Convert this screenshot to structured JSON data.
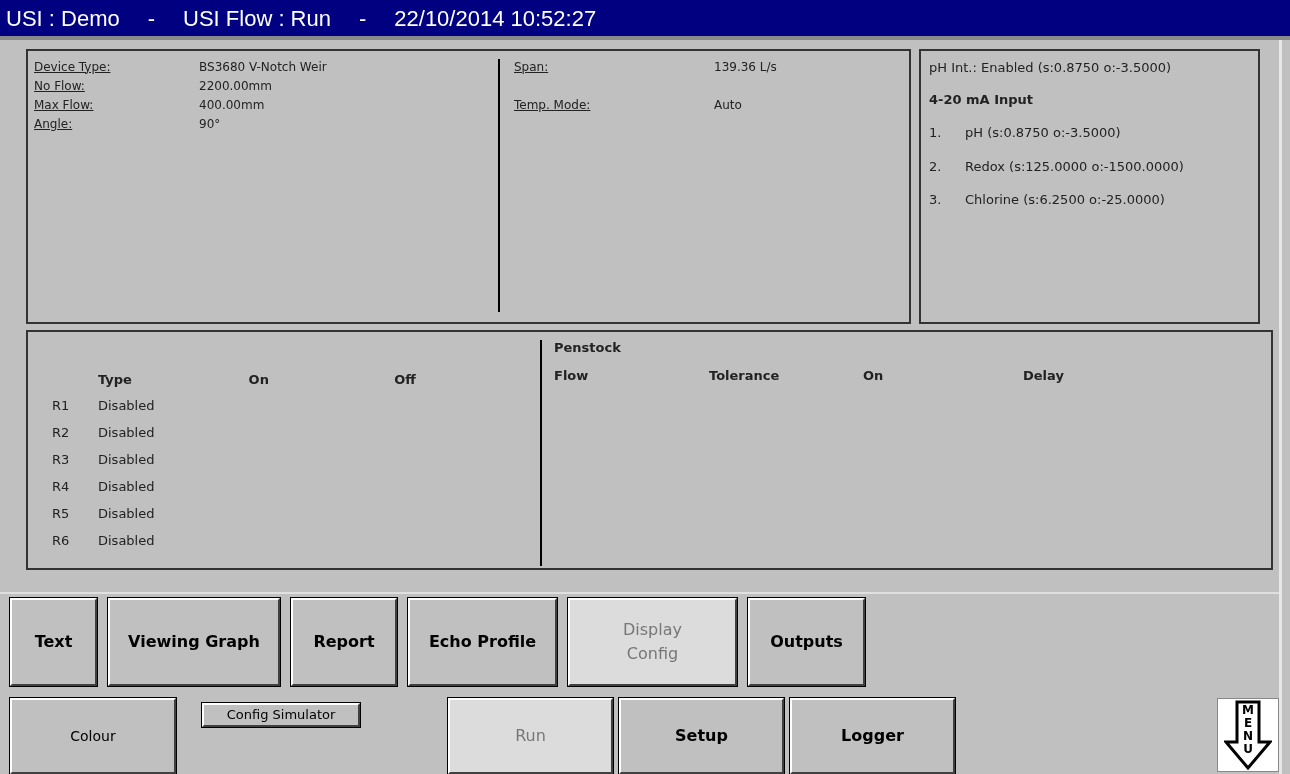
{
  "title_bar": {
    "title": "USI : Demo",
    "separator_1": "-",
    "subtitle": "USI Flow : Run",
    "separator_2": "-",
    "datetime": "22/10/2014 10:52:27"
  },
  "device_panel": {
    "left": [
      {
        "label": "Device Type:",
        "value": "BS3680 V-Notch Weir"
      },
      {
        "label": "No Flow:",
        "value": "2200.00mm"
      },
      {
        "label": "Max Flow:",
        "value": "400.00mm"
      },
      {
        "label": "Angle:",
        "value": "90°"
      }
    ],
    "right": [
      {
        "label": "Span:",
        "value": "139.36 L/s"
      },
      {
        "label": "Temp. Mode:",
        "value": "Auto"
      }
    ]
  },
  "input_panel": {
    "ph_int": "pH Int.: Enabled (s:0.8750 o:-3.5000)",
    "heading": "4-20 mA Input",
    "items": [
      {
        "number": "1.",
        "text": "pH (s:0.8750 o:-3.5000)"
      },
      {
        "number": "2.",
        "text": "Redox (s:125.0000 o:-1500.0000)"
      },
      {
        "number": "3.",
        "text": "Chlorine (s:6.2500 o:-25.0000)"
      }
    ]
  },
  "relay_panel": {
    "columns": [
      "Type",
      "On",
      "Off"
    ],
    "rows": [
      {
        "relay": "R1",
        "type": "Disabled"
      },
      {
        "relay": "R2",
        "type": "Disabled"
      },
      {
        "relay": "R3",
        "type": "Disabled"
      },
      {
        "relay": "R4",
        "type": "Disabled"
      },
      {
        "relay": "R5",
        "type": "Disabled"
      },
      {
        "relay": "R6",
        "type": "Disabled"
      }
    ],
    "penstock_title": "Penstock",
    "penstock_columns": [
      "Flow",
      "Tolerance",
      "On",
      "Delay"
    ]
  },
  "top_buttons": [
    {
      "label": "Text",
      "selected": false
    },
    {
      "label": "Viewing Graph",
      "selected": false
    },
    {
      "label": "Report",
      "selected": false
    },
    {
      "label": "Echo Profile",
      "selected": false
    },
    {
      "label": "Display Config",
      "selected": true
    },
    {
      "label": "Outputs",
      "selected": false
    }
  ],
  "bottom_buttons": {
    "colour": "Colour",
    "config_simulator": "Config Simulator",
    "nav": [
      {
        "label": "Run",
        "selected": true
      },
      {
        "label": "Setup",
        "selected": false
      },
      {
        "label": "Logger",
        "selected": false
      }
    ]
  },
  "menu_button": "MENU"
}
